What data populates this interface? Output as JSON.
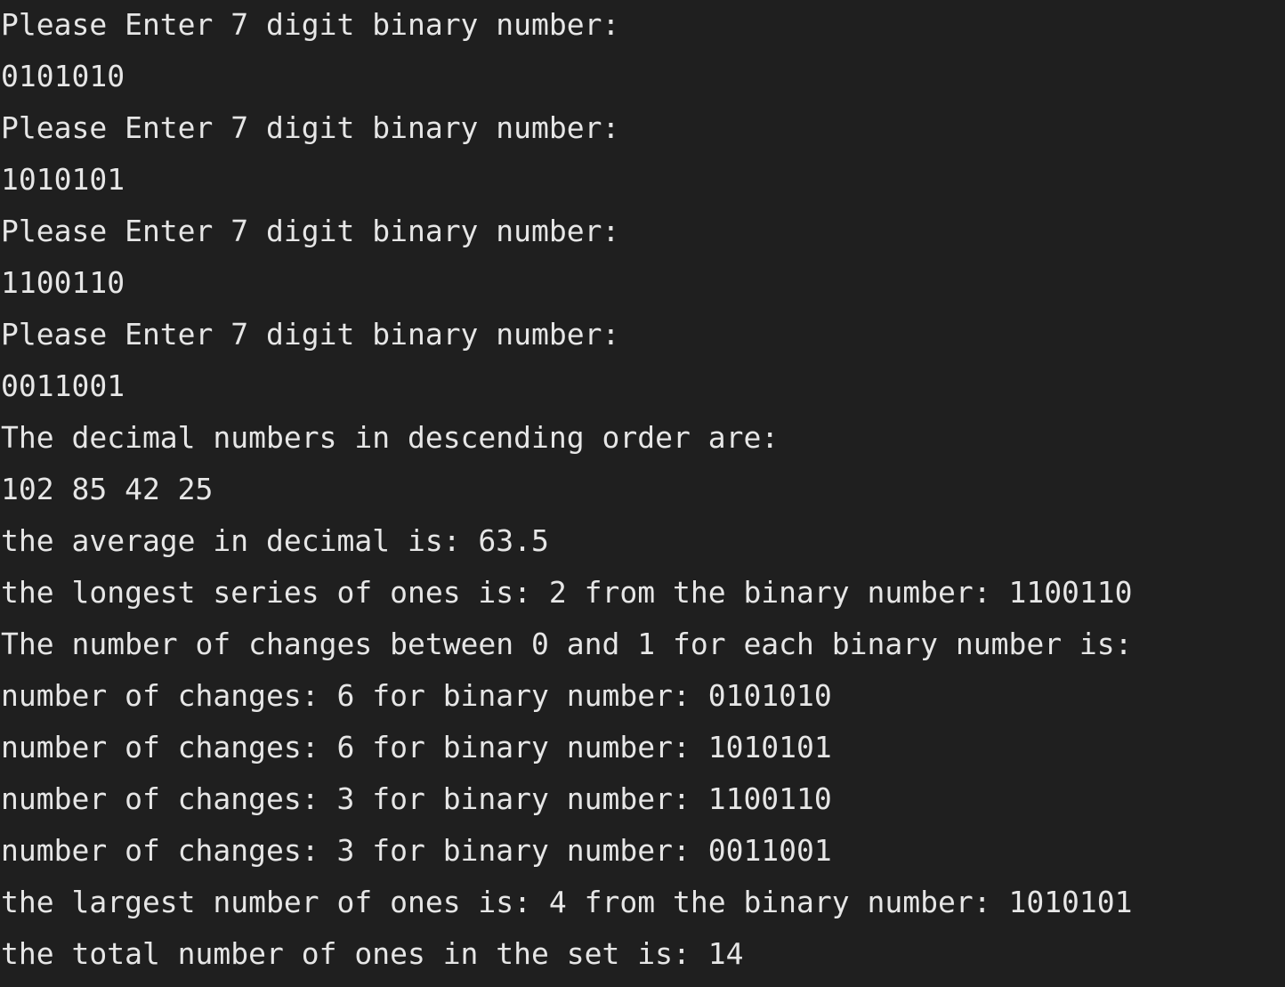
{
  "console": {
    "lines": [
      "Please Enter 7 digit binary number:",
      "0101010",
      "Please Enter 7 digit binary number:",
      "1010101",
      "Please Enter 7 digit binary number:",
      "1100110",
      "Please Enter 7 digit binary number:",
      "0011001",
      "The decimal numbers in descending order are:",
      "102 85 42 25",
      "the average in decimal is: 63.5",
      "the longest series of ones is: 2 from the binary number: 1100110",
      "The number of changes between 0 and 1 for each binary number is:",
      "number of changes: 6 for binary number: 0101010",
      "number of changes: 6 for binary number: 1010101",
      "number of changes: 3 for binary number: 1100110",
      "number of changes: 3 for binary number: 0011001",
      "the largest number of ones is: 4 from the binary number: 1010101",
      "the total number of ones in the set is: 14"
    ],
    "background_color": "#1f1f1f",
    "text_color": "#e6e6e6"
  }
}
